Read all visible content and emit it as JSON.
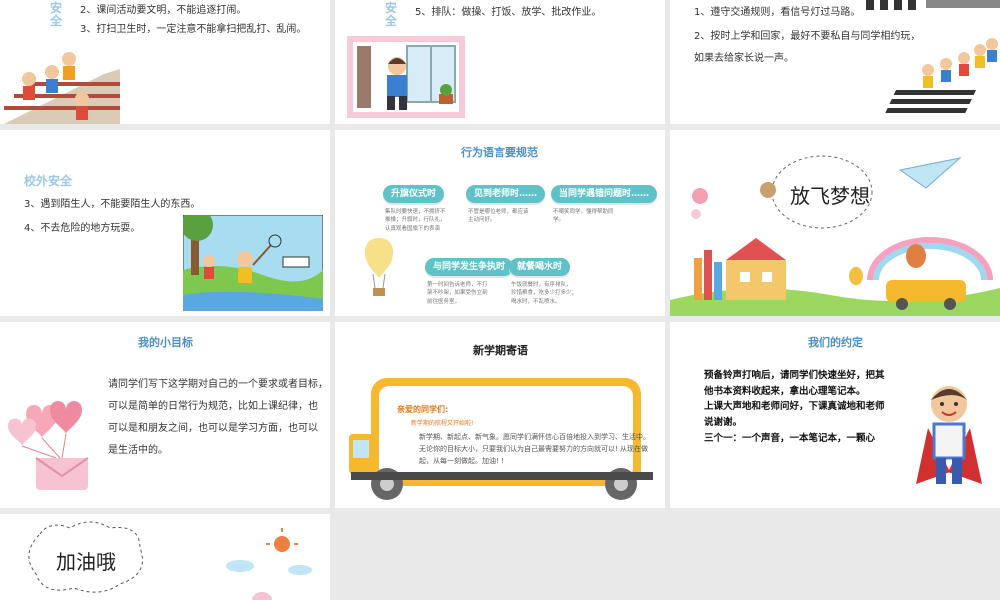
{
  "slide1": {
    "title": "安全",
    "items": [
      "2、课间活动要文明，不能追逐打闹。",
      "3、打扫卫生时，一定注意不能拿扫把乱打、乱闹。"
    ]
  },
  "slide2": {
    "title": "安全",
    "items": [
      "5、排队：做操、打饭、放学、批改作业。"
    ]
  },
  "slide3": {
    "items": [
      "1、遵守交通规则，看信号灯过马路。",
      "2、按时上学和回家，最好不要私自与同学相约玩，",
      "如果去给家长说一声。"
    ]
  },
  "slide4": {
    "title": "校外安全",
    "items": [
      "3、遇到陌生人，不能要陌生人的东西。",
      "4、不去危险的地方玩耍。"
    ]
  },
  "slide5": {
    "title": "行为语言要规范",
    "pills": [
      {
        "label": "升旗仪式时",
        "desc": [
          "集队时要快速，不拥挤不",
          "推搡；升旗时，行队礼，",
          "认真观看国旗下的表演"
        ]
      },
      {
        "label": "见到老师时……",
        "desc": [
          "不管是哪位老师，都应该",
          "主动问好。"
        ]
      },
      {
        "label": "当同学遇错问题时……",
        "desc": [
          "不嘲笑同学，懂得帮助同",
          "学。"
        ]
      },
      {
        "label": "与同学发生争执时",
        "desc": [
          "第一时间告诉老师，不打",
          "架不吵架，如果受伤立刻",
          "前往医务室。"
        ]
      },
      {
        "label": "就餐喝水时",
        "desc": [
          "午饭就餐时，有序排队，",
          "珍惜粮食，吃多少打多少；",
          "喝水时，不乱喷水。"
        ]
      }
    ]
  },
  "slide6": {
    "title": "放飞梦想"
  },
  "slide7": {
    "title": "我的小目标",
    "lines": [
      "请同学们写下这学期对自己的一个要求或者目标，",
      "可以是简单的日常行为规范，比如上课纪律，也",
      "可以是和朋友之间，也可以是学习方面，也可以",
      "是生活中的。"
    ]
  },
  "slide8": {
    "title": "新学期寄语",
    "greeting": "亲爱的同学们:",
    "subtitle": "新学期的航程又开始啦!",
    "lines": [
      "新学期、新起点、新气象。愿同学们满怀信心百倍地投入到学习、生活中。",
      "无论你的目标大小，只要我们认为自己最需要努力的方向就可以! 从现在做",
      "起，从每一刻做起。加油! !"
    ]
  },
  "slide9": {
    "title": "我们的约定",
    "lines": [
      "预备铃声打响后，请同学们快速坐好，把其",
      "他书本资料收起来，拿出心理笔记本。",
      "上课大声地和老师问好，下课真诚地和老师",
      "说谢谢。",
      "三个一：一个声音，一本笔记本，一颗心"
    ]
  },
  "slide10": {
    "title": "加油哦"
  },
  "colors": {
    "accent_blue": "#4a90c8",
    "teal": "#5fc2c8",
    "light_blue": "#9cc8e8",
    "bus_yellow": "#f5b82e"
  }
}
